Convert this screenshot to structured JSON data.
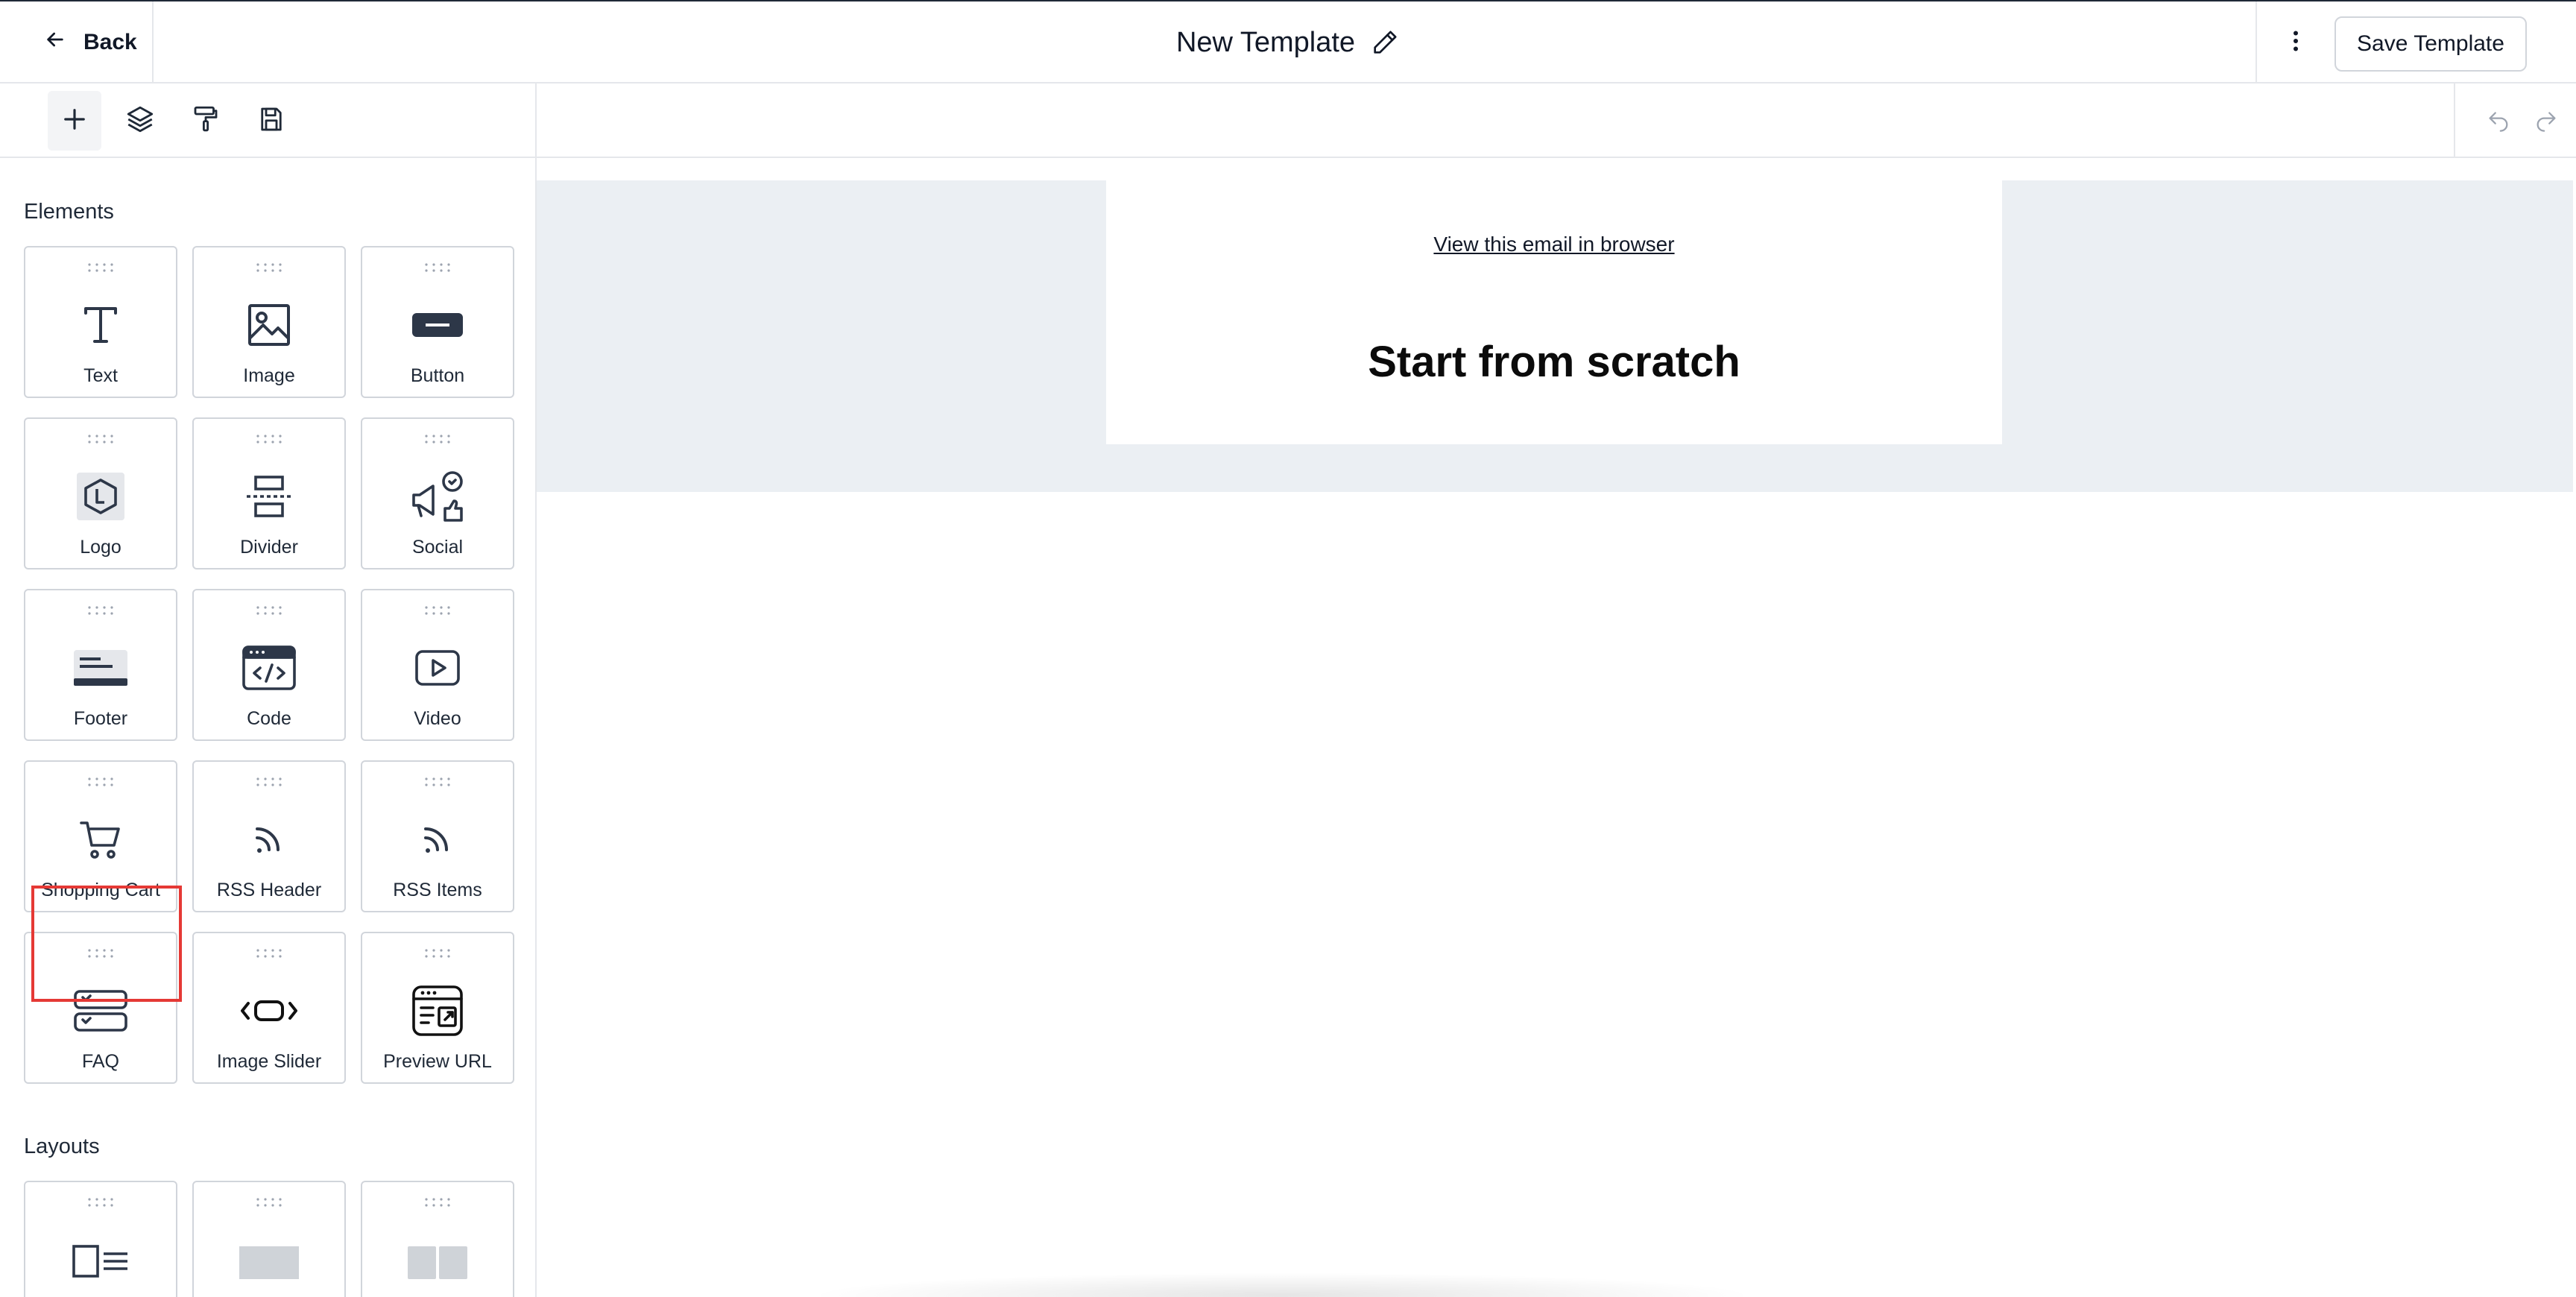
{
  "header": {
    "back_label": "Back",
    "title": "New Template",
    "save_label": "Save Template"
  },
  "sidebar": {
    "tools": [
      {
        "icon": "plus-icon",
        "active": true
      },
      {
        "icon": "layers-icon",
        "active": false
      },
      {
        "icon": "paint-roller-icon",
        "active": false
      },
      {
        "icon": "save-icon",
        "active": false
      }
    ],
    "elements_title": "Elements",
    "elements": [
      {
        "label": "Text",
        "icon": "text-icon"
      },
      {
        "label": "Image",
        "icon": "image-icon"
      },
      {
        "label": "Button",
        "icon": "button-icon"
      },
      {
        "label": "Logo",
        "icon": "logo-icon"
      },
      {
        "label": "Divider",
        "icon": "divider-icon"
      },
      {
        "label": "Social",
        "icon": "social-icon"
      },
      {
        "label": "Footer",
        "icon": "footer-icon"
      },
      {
        "label": "Code",
        "icon": "code-icon"
      },
      {
        "label": "Video",
        "icon": "video-icon"
      },
      {
        "label": "Shopping Cart",
        "icon": "shopping-cart-icon",
        "highlighted": true
      },
      {
        "label": "RSS Header",
        "icon": "rss-icon"
      },
      {
        "label": "RSS Items",
        "icon": "rss-icon"
      },
      {
        "label": "FAQ",
        "icon": "faq-icon"
      },
      {
        "label": "Image Slider",
        "icon": "image-slider-icon"
      },
      {
        "label": "Preview URL",
        "icon": "preview-url-icon"
      }
    ],
    "layouts_title": "Layouts",
    "layouts": [
      {
        "icon": "layout-image-text-icon"
      },
      {
        "icon": "layout-single-column-icon"
      },
      {
        "icon": "layout-two-column-icon"
      }
    ]
  },
  "canvas": {
    "view_in_browser": "View this email in browser",
    "heading": "Start from scratch"
  },
  "colors": {
    "highlight": "#e53935",
    "canvas_band": "#ebeff3",
    "icon": "#2d3748",
    "border": "#d1d5db"
  }
}
